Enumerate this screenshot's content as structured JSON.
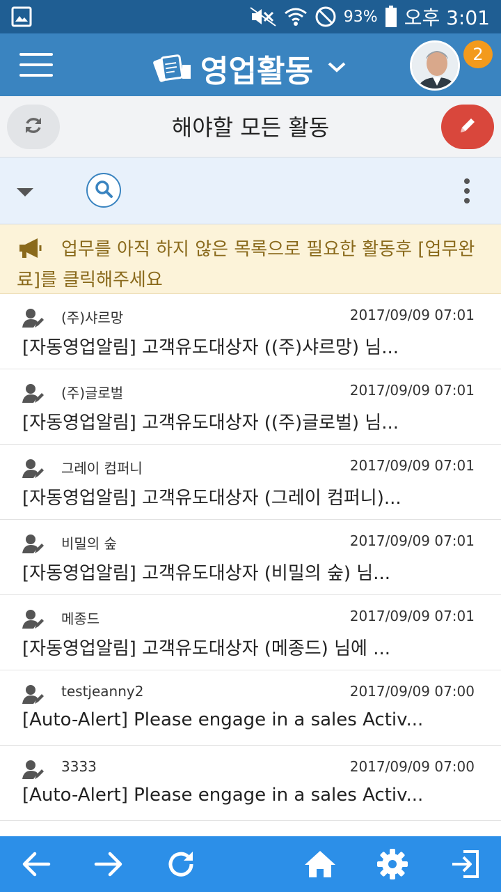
{
  "status_bar": {
    "battery": "93%",
    "time": "오후 3:01"
  },
  "app_bar": {
    "title": "영업활동",
    "notification_count": "2"
  },
  "sub_header": {
    "title": "해야할 모든 활동"
  },
  "notice": {
    "text": "업무를 아직 하지 않은 목록으로 필요한 활동후 [업무완료]를 클릭해주세요"
  },
  "activities": [
    {
      "company": "(주)샤르망",
      "date": "2017/09/09 07:01",
      "subject": "[자동영업알림] 고객유도대상자 ((주)샤르망) 님..."
    },
    {
      "company": "(주)글로벌",
      "date": "2017/09/09 07:01",
      "subject": "[자동영업알림] 고객유도대상자 ((주)글로벌) 님..."
    },
    {
      "company": "그레이 컴퍼니",
      "date": "2017/09/09 07:01",
      "subject": "[자동영업알림] 고객유도대상자 (그레이 컴퍼니)..."
    },
    {
      "company": "비밀의 숲",
      "date": "2017/09/09 07:01",
      "subject": "[자동영업알림] 고객유도대상자 (비밀의 숲) 님..."
    },
    {
      "company": "메종드",
      "date": "2017/09/09 07:01",
      "subject": "[자동영업알림] 고객유도대상자 (메종드) 님에 ..."
    },
    {
      "company": "testjeanny2",
      "date": "2017/09/09 07:00",
      "subject": "[Auto-Alert] Please engage in a sales Activ..."
    },
    {
      "company": "3333",
      "date": "2017/09/09 07:00",
      "subject": "[Auto-Alert] Please engage in a sales Activ..."
    }
  ],
  "icons": {
    "menu": "hamburger-icon",
    "title": "sales-cards-icon",
    "dropdown": "chevron-down-icon",
    "refresh": "refresh-icon",
    "edit": "pencil-icon",
    "search": "search-icon",
    "more": "more-vert-icon",
    "notice": "megaphone-icon",
    "user": "user-edit-icon",
    "back": "arrow-left-icon",
    "forward": "arrow-right-icon",
    "reload": "reload-icon",
    "home": "home-icon",
    "settings": "gear-icon",
    "logout": "exit-icon"
  },
  "colors": {
    "status_bar": "#1f5e93",
    "app_bar": "#3a84c0",
    "edit_button": "#d9473c",
    "badge": "#f39a1c",
    "notice_bg": "#fcf3d9",
    "notice_text": "#8a6a1c",
    "bottom_nav": "#2c8fe8"
  }
}
